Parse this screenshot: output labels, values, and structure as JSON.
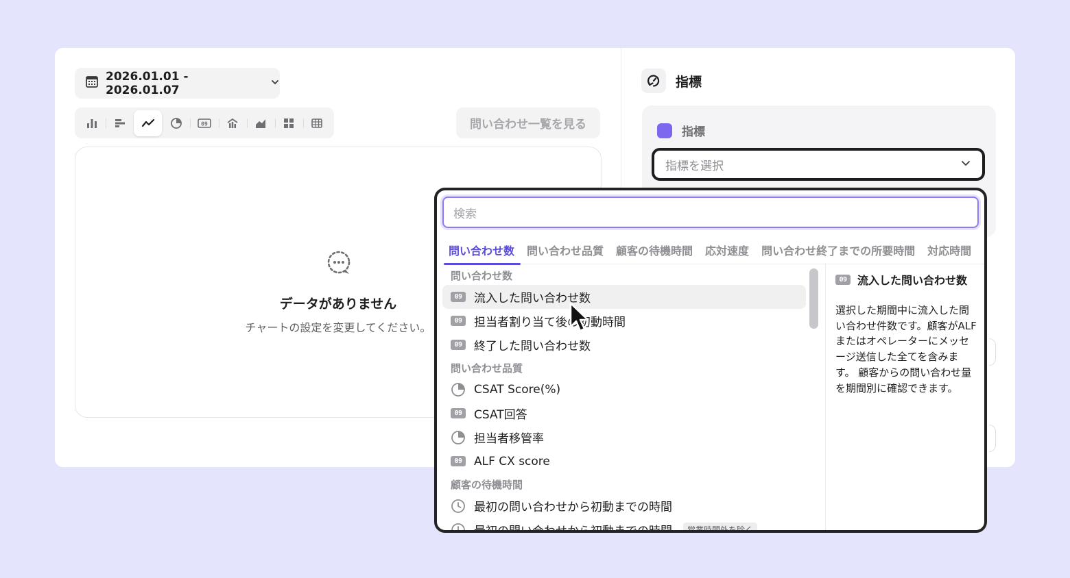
{
  "date_range": {
    "label": "2026.01.01 - 2026.01.07"
  },
  "chart_toolbar": {
    "items": [
      {
        "name": "bar-chart-icon"
      },
      {
        "name": "horizontal-bar-icon"
      },
      {
        "name": "line-chart-icon",
        "active": true
      },
      {
        "name": "pie-chart-icon"
      },
      {
        "name": "number-icon",
        "text": "09"
      },
      {
        "name": "funnel-chart-icon"
      },
      {
        "name": "area-chart-icon"
      },
      {
        "name": "grid-icon"
      },
      {
        "name": "table-icon"
      }
    ]
  },
  "list_button": {
    "label": "問い合わせ一覧を見る"
  },
  "empty_state": {
    "title": "データがありません",
    "subtitle": "チャートの設定を変更してください。"
  },
  "panel": {
    "title": "指標",
    "metric_label": "指標",
    "metric_color": "#7b68ee",
    "select_placeholder": "指標を選択"
  },
  "dropdown": {
    "search_placeholder": "検索",
    "tabs": [
      "問い合わせ数",
      "問い合わせ品質",
      "顧客の待機時間",
      "応対速度",
      "問い合わせ終了までの所要時間",
      "対応時間"
    ],
    "groups": [
      {
        "title": "問い合わせ数",
        "items": [
          {
            "icon": "number",
            "label": "流入した問い合わせ数"
          },
          {
            "icon": "number",
            "label": "担当者割り当て後の初動時間"
          },
          {
            "icon": "number",
            "label": "終了した問い合わせ数"
          }
        ]
      },
      {
        "title": "問い合わせ品質",
        "items": [
          {
            "icon": "pie",
            "label": "CSAT Score(%)"
          },
          {
            "icon": "number",
            "label": "CSAT回答"
          },
          {
            "icon": "pie",
            "label": "担当者移管率"
          },
          {
            "icon": "number",
            "label": "ALF CX score"
          }
        ]
      },
      {
        "title": "顧客の待機時間",
        "items": [
          {
            "icon": "clock",
            "label": "最初の問い合わせから初動までの時間"
          },
          {
            "icon": "clock",
            "label": "最初の問い合わせから初動までの時間",
            "tag": "営業時間外を除く"
          }
        ]
      }
    ],
    "number_icon_text": "09",
    "description": {
      "title": "流入した問い合わせ数",
      "text": "選択した期間中に流入した問い合わせ件数です。顧客がALFまたはオペレーターにメッセージ送信した全てを含みます。 顧客からの問い合わせ量を期間別に確認できます。"
    }
  }
}
